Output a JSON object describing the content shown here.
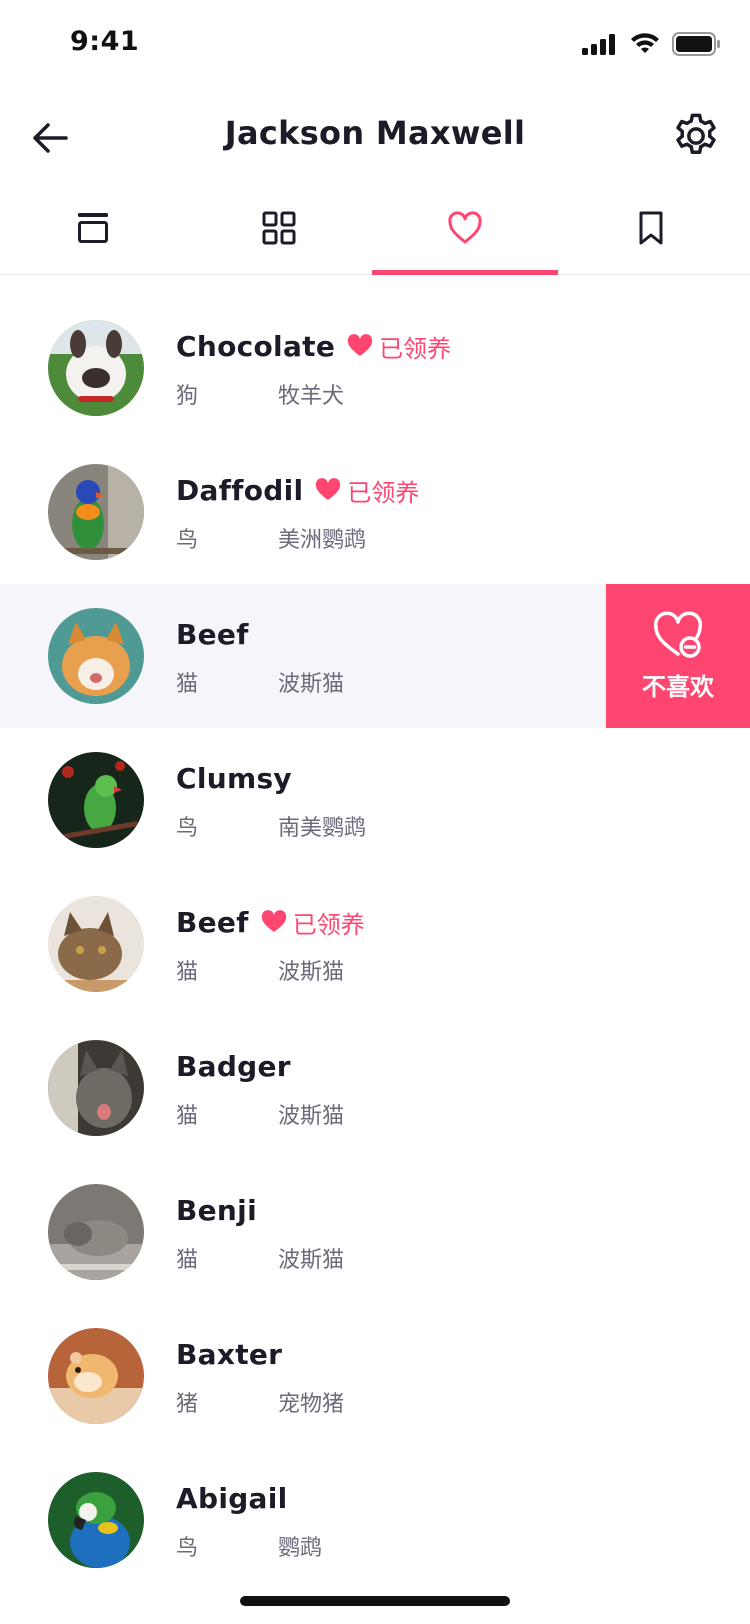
{
  "status_bar": {
    "time": "9:41"
  },
  "header": {
    "title": "Jackson Maxwell"
  },
  "tabs": [
    {
      "name": "feed",
      "icon": "feed-icon",
      "active": false
    },
    {
      "name": "grid",
      "icon": "grid-icon",
      "active": false
    },
    {
      "name": "likes",
      "icon": "heart-icon",
      "active": true
    },
    {
      "name": "saved",
      "icon": "bookmark-icon",
      "active": false
    }
  ],
  "colors": {
    "accent": "#ff4670",
    "text": "#1c1c28",
    "muted": "#6b6b7b",
    "highlight_row": "#f6f6fa"
  },
  "pets": [
    {
      "name": "Chocolate",
      "adopted": true,
      "adopted_label": "已领养",
      "species": "狗",
      "breed": "牧羊犬"
    },
    {
      "name": "Daffodil",
      "adopted": true,
      "adopted_label": "已领养",
      "species": "鸟",
      "breed": "美洲鹦鹉"
    },
    {
      "name": "Beef",
      "adopted": false,
      "species": "猫",
      "breed": "波斯猫",
      "swiped": true
    },
    {
      "name": "Clumsy",
      "adopted": false,
      "species": "鸟",
      "breed": "南美鹦鹉"
    },
    {
      "name": "Beef",
      "adopted": true,
      "adopted_label": "已领养",
      "species": "猫",
      "breed": "波斯猫"
    },
    {
      "name": "Badger",
      "adopted": false,
      "species": "猫",
      "breed": "波斯猫"
    },
    {
      "name": "Benji",
      "adopted": false,
      "species": "猫",
      "breed": "波斯猫"
    },
    {
      "name": "Baxter",
      "adopted": false,
      "species": "猪",
      "breed": "宠物猪"
    },
    {
      "name": "Abigail",
      "adopted": false,
      "species": "鸟",
      "breed": "鹦鹉"
    }
  ],
  "swipe_action": {
    "label": "不喜欢",
    "icon": "heart-minus-icon"
  }
}
